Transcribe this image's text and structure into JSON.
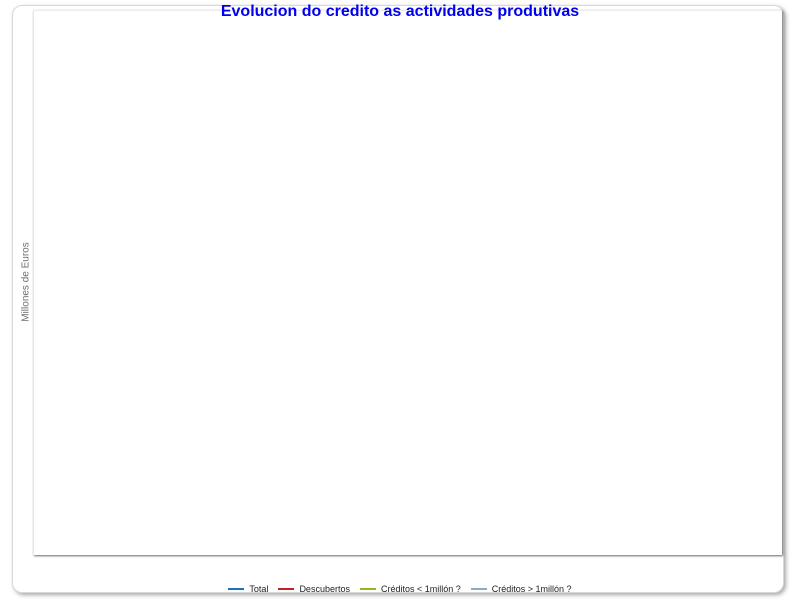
{
  "chart_data": {
    "type": "line",
    "title": "Evolucion do credito as actividades produtivas",
    "xlabel": "",
    "ylabel": "Millones de Euros",
    "x": [],
    "series": [
      {
        "name": "Total",
        "color": "#1f6fc4",
        "values": []
      },
      {
        "name": "Descubertos",
        "color": "#c0231d",
        "values": []
      },
      {
        "name": "Créditos < 1millón ?",
        "color": "#8fb820",
        "values": []
      },
      {
        "name": "Créditos > 1millón ?",
        "color": "#8fa8c4",
        "values": []
      }
    ],
    "grid": false,
    "legend": "bottom"
  }
}
